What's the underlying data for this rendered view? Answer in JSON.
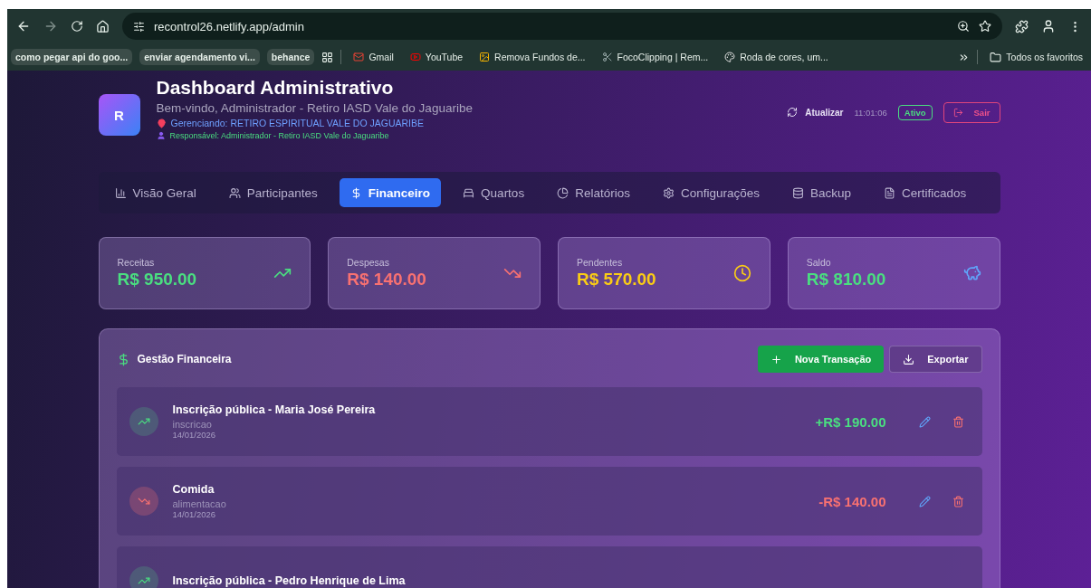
{
  "browser": {
    "address": "recontrol26.netlify.app/admin",
    "bookmarks": [
      {
        "label": "como pegar api do goo...",
        "kind": "chip"
      },
      {
        "label": "enviar agendamento vi...",
        "kind": "chip"
      },
      {
        "label": "behance",
        "kind": "chip"
      },
      {
        "label": "Gmail",
        "kind": "mail"
      },
      {
        "label": "YouTube",
        "kind": "video"
      },
      {
        "label": "Remova Fundos de...",
        "kind": "site"
      },
      {
        "label": "FocoClipping | Rem...",
        "kind": "clip"
      },
      {
        "label": "Roda de cores, um...",
        "kind": "wheel"
      }
    ],
    "all_bookmarks": "Todos os favoritos"
  },
  "header": {
    "avatar": "R",
    "title": "Dashboard Administrativo",
    "subtitle": "Bem-vindo, Administrador - Retiro IASD Vale do Jaguaribe",
    "managing": "Gerenciando: RETIRO ESPIRITUAL VALE DO JAGUARIBE",
    "responsible": "Responsável: Administrador - Retiro IASD Vale do Jaguaribe",
    "refresh": "Atualizar",
    "time": "11:01:06",
    "status": "Ativo",
    "logout": "Sair"
  },
  "tabs": [
    {
      "label": "Visão Geral",
      "kind": "chart",
      "selected": false
    },
    {
      "label": "Participantes",
      "kind": "users",
      "selected": false
    },
    {
      "label": "Financeiro",
      "kind": "money",
      "selected": true
    },
    {
      "label": "Quartos",
      "kind": "bed",
      "selected": false
    },
    {
      "label": "Relatórios",
      "kind": "pie",
      "selected": false
    },
    {
      "label": "Configurações",
      "kind": "gear",
      "selected": false
    },
    {
      "label": "Backup",
      "kind": "database",
      "selected": false
    },
    {
      "label": "Certificados",
      "kind": "file",
      "selected": false
    }
  ],
  "stats": [
    {
      "label": "Receitas",
      "value": "R$ 950.00",
      "kind": "income"
    },
    {
      "label": "Despesas",
      "value": "R$ 140.00",
      "kind": "expense"
    },
    {
      "label": "Pendentes",
      "value": "R$ 570.00",
      "kind": "pending"
    },
    {
      "label": "Saldo",
      "value": "R$ 810.00",
      "kind": "balance"
    }
  ],
  "finance": {
    "title": "Gestão Financeira",
    "new_button": "Nova Transação",
    "export_button": "Exportar",
    "transactions": [
      {
        "kind": "income",
        "title": "Inscrição pública - Maria José Pereira",
        "category": "inscricao",
        "date": "14/01/2026",
        "amount": "+R$ 190.00"
      },
      {
        "kind": "expense",
        "title": "Comida",
        "category": "alimentacao",
        "date": "14/01/2026",
        "amount": "-R$ 140.00"
      },
      {
        "kind": "income",
        "title": "Inscrição pública - Pedro Henrique de Lima"
      }
    ]
  }
}
